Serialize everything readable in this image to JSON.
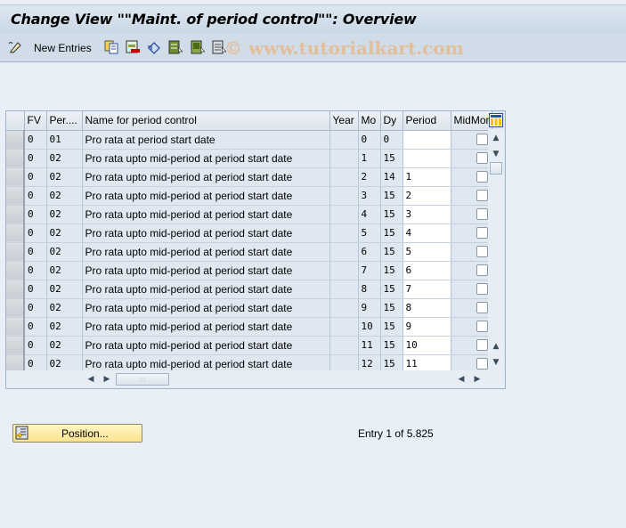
{
  "window": {
    "title": "Change View \"\"Maint. of period control\"\": Overview"
  },
  "toolbar": {
    "new_entries_label": "New Entries",
    "icons": [
      "change-display-icon",
      "copy-icon",
      "delete-icon",
      "undo-change-icon",
      "select-all-icon",
      "select-block-icon",
      "deselect-all-icon"
    ],
    "watermark": "© www.tutorialkart.com"
  },
  "table": {
    "columns": [
      "FV",
      "Per....",
      "Name for period control",
      "Year",
      "Mo",
      "Dy",
      "Period",
      "MidMon"
    ],
    "rows": [
      {
        "fv": "0",
        "per": "01",
        "name": "Pro rata at period start date",
        "year": "",
        "mo": "0",
        "dy": "0",
        "period": "",
        "midmon": false
      },
      {
        "fv": "0",
        "per": "02",
        "name": "Pro rata upto mid-period at period start date",
        "year": "",
        "mo": "1",
        "dy": "15",
        "period": "",
        "midmon": false
      },
      {
        "fv": "0",
        "per": "02",
        "name": "Pro rata upto mid-period at period start date",
        "year": "",
        "mo": "2",
        "dy": "14",
        "period": "1",
        "midmon": false
      },
      {
        "fv": "0",
        "per": "02",
        "name": "Pro rata upto mid-period at period start date",
        "year": "",
        "mo": "3",
        "dy": "15",
        "period": "2",
        "midmon": false
      },
      {
        "fv": "0",
        "per": "02",
        "name": "Pro rata upto mid-period at period start date",
        "year": "",
        "mo": "4",
        "dy": "15",
        "period": "3",
        "midmon": false
      },
      {
        "fv": "0",
        "per": "02",
        "name": "Pro rata upto mid-period at period start date",
        "year": "",
        "mo": "5",
        "dy": "15",
        "period": "4",
        "midmon": false
      },
      {
        "fv": "0",
        "per": "02",
        "name": "Pro rata upto mid-period at period start date",
        "year": "",
        "mo": "6",
        "dy": "15",
        "period": "5",
        "midmon": false
      },
      {
        "fv": "0",
        "per": "02",
        "name": "Pro rata upto mid-period at period start date",
        "year": "",
        "mo": "7",
        "dy": "15",
        "period": "6",
        "midmon": false
      },
      {
        "fv": "0",
        "per": "02",
        "name": "Pro rata upto mid-period at period start date",
        "year": "",
        "mo": "8",
        "dy": "15",
        "period": "7",
        "midmon": false
      },
      {
        "fv": "0",
        "per": "02",
        "name": "Pro rata upto mid-period at period start date",
        "year": "",
        "mo": "9",
        "dy": "15",
        "period": "8",
        "midmon": false
      },
      {
        "fv": "0",
        "per": "02",
        "name": "Pro rata upto mid-period at period start date",
        "year": "",
        "mo": "10",
        "dy": "15",
        "period": "9",
        "midmon": false
      },
      {
        "fv": "0",
        "per": "02",
        "name": "Pro rata upto mid-period at period start date",
        "year": "",
        "mo": "11",
        "dy": "15",
        "period": "10",
        "midmon": false
      },
      {
        "fv": "0",
        "per": "02",
        "name": "Pro rata upto mid-period at period start date",
        "year": "",
        "mo": "12",
        "dy": "15",
        "period": "11",
        "midmon": false
      }
    ]
  },
  "footer": {
    "position_label": "Position...",
    "entry_text": "Entry 1 of 5.825"
  }
}
